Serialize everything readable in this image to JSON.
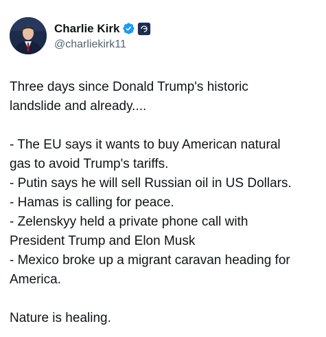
{
  "author": {
    "display_name": "Charlie Kirk",
    "handle": "@charliekirk11",
    "verified_icon": "verified-badge-icon",
    "affiliation_icon": "organization-badge-icon"
  },
  "tweet": {
    "lines": [
      "Three days since Donald Trump's historic",
      "landslide and already....",
      "",
      "- The EU says it wants to buy American natural",
      "gas to avoid Trump's tariffs.",
      "- Putin says he will sell Russian oil in US Dollars.",
      "- Hamas is calling for peace.",
      "- Zelenskyy held a private phone call with",
      "President Trump and Elon Musk",
      "- Mexico broke up a migrant caravan heading for",
      "America.",
      "",
      "Nature is healing."
    ]
  },
  "colors": {
    "text_primary": "#0f1419",
    "text_secondary": "#536471",
    "verified_blue": "#1d9bf0",
    "badge_navy": "#1f2d4d"
  }
}
